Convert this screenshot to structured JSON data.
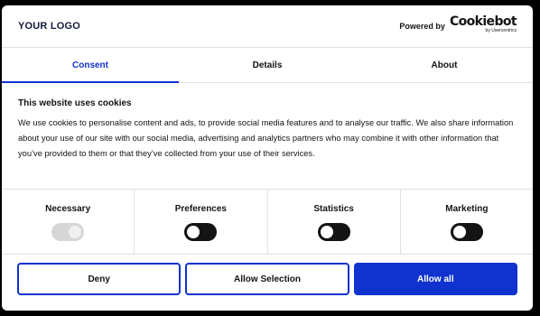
{
  "header": {
    "logo_text": "YOUR LOGO",
    "powered_by_label": "Powered by",
    "brand_name": "Cookiebot",
    "brand_sub": "by Usercentrics"
  },
  "tabs": [
    {
      "label": "Consent",
      "active": true
    },
    {
      "label": "Details",
      "active": false
    },
    {
      "label": "About",
      "active": false
    }
  ],
  "content": {
    "title": "This website uses cookies",
    "description": "We use cookies to personalise content and ads, to provide social media features and to analyse our traffic. We also share information about your use of our site with our social media, advertising and analytics partners who may combine it with other information that you’ve provided to them or that they’ve collected from your use of their services."
  },
  "categories": [
    {
      "label": "Necessary",
      "state": "on",
      "disabled": true
    },
    {
      "label": "Preferences",
      "state": "off",
      "disabled": false
    },
    {
      "label": "Statistics",
      "state": "off",
      "disabled": false
    },
    {
      "label": "Marketing",
      "state": "off",
      "disabled": false
    }
  ],
  "actions": {
    "deny_label": "Deny",
    "allow_selection_label": "Allow Selection",
    "allow_all_label": "Allow all"
  },
  "colors": {
    "accent": "#1032cf",
    "toggle_off": "#141414",
    "toggle_disabled": "#d6d6d6"
  }
}
